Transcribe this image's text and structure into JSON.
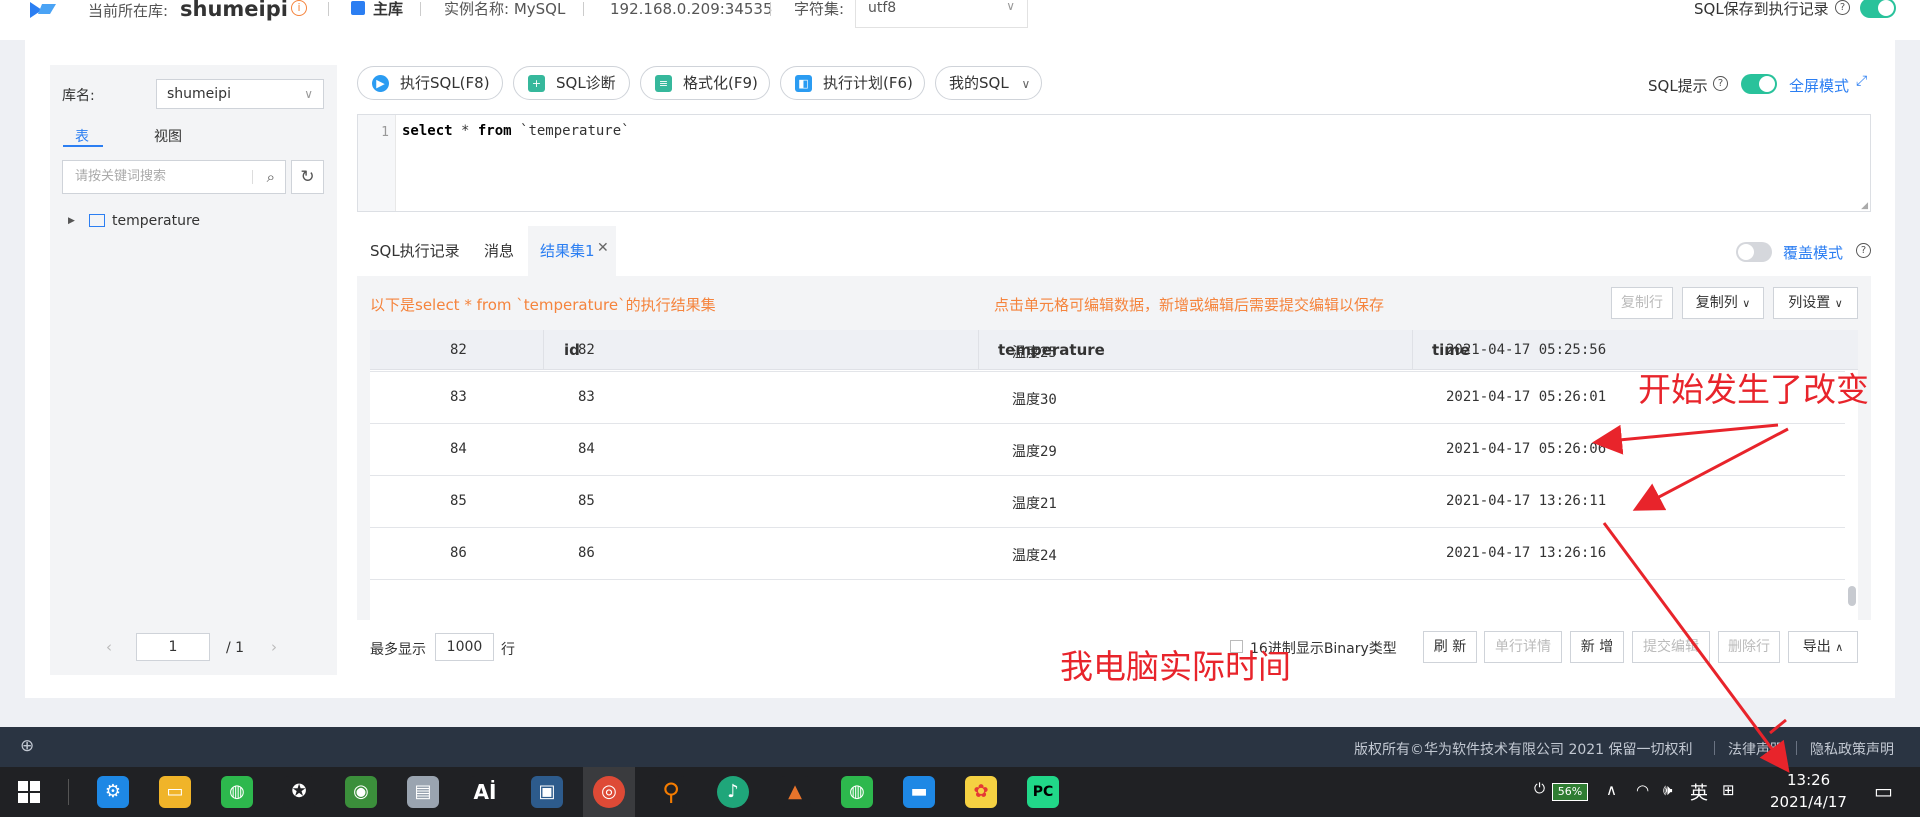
{
  "topbar": {
    "current_db_label": "当前所在库:",
    "current_db": "shumeipi",
    "primary_label": "主库",
    "instance": "实例名称: MySQL",
    "host": "192.168.0.209:34535",
    "charset_label": "字符集:",
    "charset_value": "utf8",
    "save_sql_label": "SQL保存到执行记录"
  },
  "left": {
    "db_label": "库名:",
    "db_value": "shumeipi",
    "tab_table": "表",
    "tab_view": "视图",
    "search_placeholder": "请按关键词搜索",
    "tree_items": [
      "temperature"
    ],
    "page_current": "1",
    "page_total": "/ 1"
  },
  "toolbar": {
    "run": "执行SQL(F8)",
    "diagnose": "SQL诊断",
    "format": "格式化(F9)",
    "plan": "执行计划(F6)",
    "my_sql": "我的SQL",
    "sql_hint": "SQL提示",
    "fullscreen": "全屏模式"
  },
  "editor": {
    "line_no": "1",
    "kw_select": "select",
    "mid": " * ",
    "kw_from": "from",
    "table": " `temperature`"
  },
  "results": {
    "tabs": [
      "SQL执行记录",
      "消息",
      "结果集1"
    ],
    "overlay_mode": "覆盖模式",
    "info": "以下是select * from `temperature`的执行结果集",
    "edit_hint": "点击单元格可编辑数据，新增或编辑后需要提交编辑以保存",
    "copy_row": "复制行",
    "copy_col": "复制列",
    "col_settings": "列设置",
    "columns": [
      "id",
      "temperature",
      "time"
    ],
    "rows": [
      {
        "rownum": "82",
        "id": "82",
        "temperature": "温度25",
        "time": "2021-04-17 05:25:56"
      },
      {
        "rownum": "83",
        "id": "83",
        "temperature": "温度30",
        "time": "2021-04-17 05:26:01"
      },
      {
        "rownum": "84",
        "id": "84",
        "temperature": "温度29",
        "time": "2021-04-17 05:26:06"
      },
      {
        "rownum": "85",
        "id": "85",
        "temperature": "温度21",
        "time": "2021-04-17 13:26:11"
      },
      {
        "rownum": "86",
        "id": "86",
        "temperature": "温度24",
        "time": "2021-04-17 13:26:16"
      }
    ],
    "max_show_label": "最多显示",
    "max_show_value": "1000",
    "max_show_unit": "行",
    "binary_label": "16进制显示Binary类型",
    "refresh": "刷 新",
    "row_detail": "单行详情",
    "add": "新 增",
    "submit": "提交编辑",
    "delete_row": "删除行",
    "export": "导出"
  },
  "footer": {
    "copyright": "版权所有©华为软件技术有限公司 2021 保留一切权利",
    "legal": "法律声明",
    "privacy": "隐私政策声明"
  },
  "annotations": {
    "change": "开始发生了改变",
    "actual_time": "我电脑实际时间"
  },
  "taskbar": {
    "battery": "56%",
    "ime": "英",
    "time": "13:26",
    "date": "2021/4/17"
  },
  "colors": {
    "accent": "#2b7ef2",
    "green": "#29c29b",
    "orange": "#f5843d",
    "annotation_red": "#e8242b"
  }
}
